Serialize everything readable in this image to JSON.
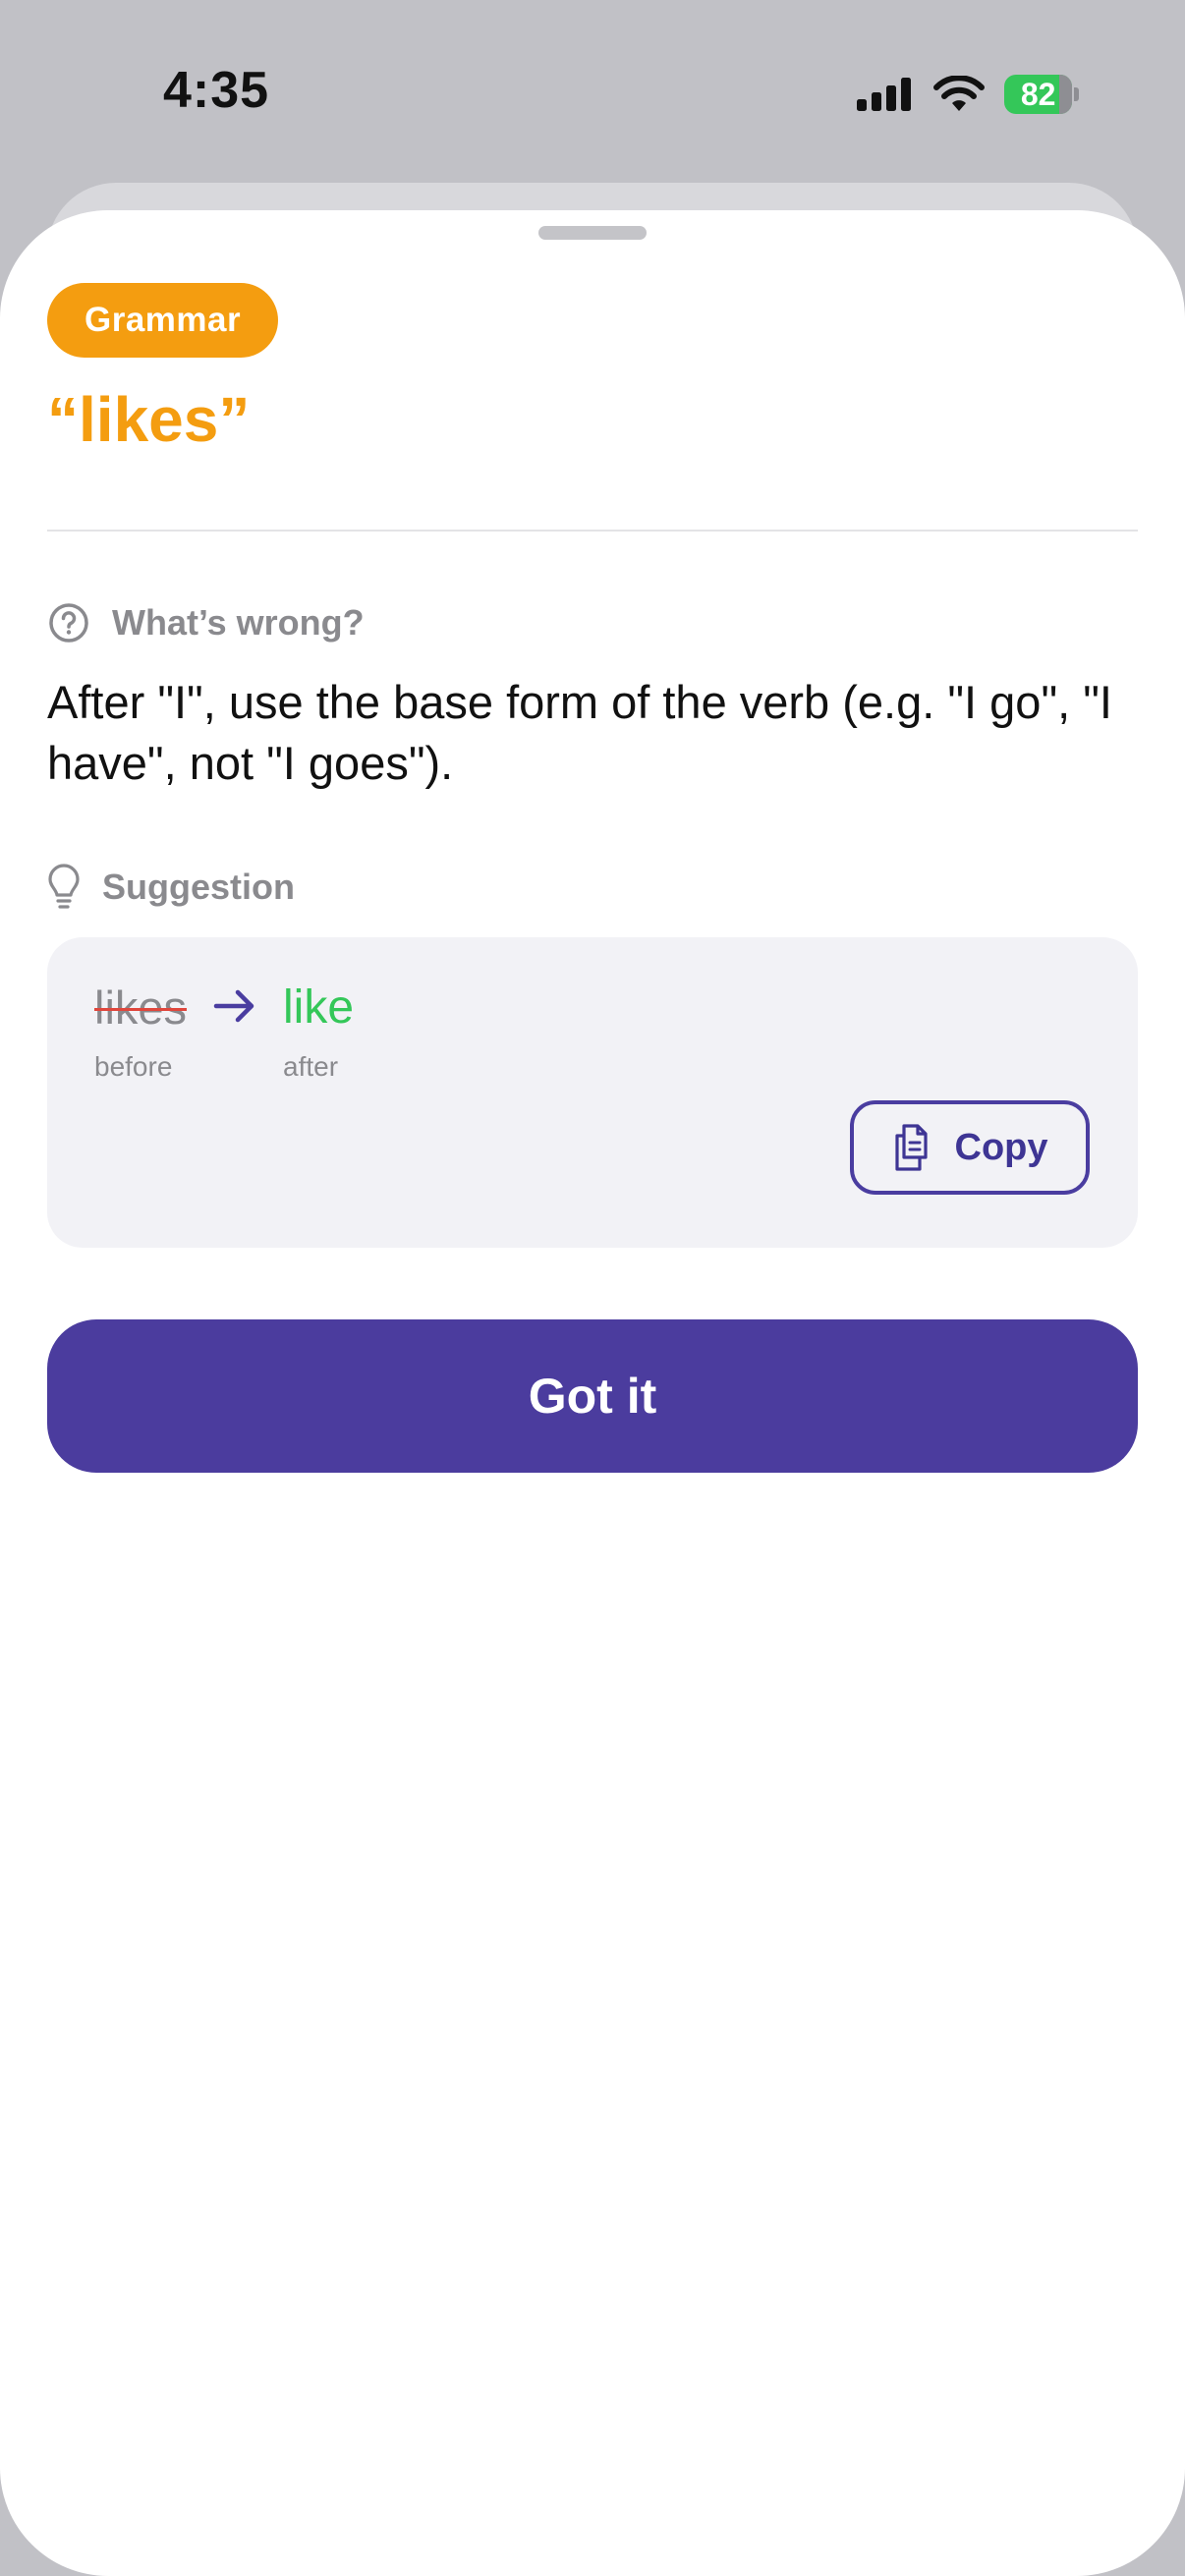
{
  "status_bar": {
    "time": "4:35",
    "battery": "82",
    "battery_color": "#34c759"
  },
  "issue": {
    "category": "Grammar",
    "category_color": "#f49d10",
    "flagged_text": "“likes”"
  },
  "whats_wrong": {
    "heading": "What’s wrong?",
    "icon": "question-circle-icon",
    "explanation": "After \"I\", use the base form of the verb (e.g. \"I go\", \"I have\", not \"I goes\")."
  },
  "suggestion": {
    "heading": "Suggestion",
    "icon": "lightbulb-icon",
    "before": "likes",
    "after": "like",
    "before_label": "before",
    "after_label": "after",
    "copy_label": "Copy",
    "after_color": "#34c759"
  },
  "actions": {
    "primary_label": "Got it",
    "primary_color": "#4b3c9e"
  }
}
